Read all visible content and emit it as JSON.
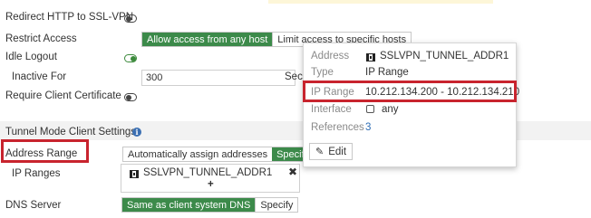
{
  "form": {
    "redirect_label": "Redirect HTTP to SSL-VPN",
    "restrict_label": "Restrict Access",
    "restrict_options": [
      "Allow access from any host",
      "Limit access to specific hosts"
    ],
    "idle_label": "Idle Logout",
    "inactive_label": "Inactive For",
    "inactive_value": "300",
    "inactive_unit_partial": "Seco",
    "client_cert_label": "Require Client Certificate",
    "tunnel_section": "Tunnel Mode Client Settings",
    "address_range_label": "Address Range",
    "address_range_options": [
      "Automatically assign addresses",
      "Specify"
    ],
    "ip_ranges_label": "IP Ranges",
    "ip_range_entry": "SSLVPN_TUNNEL_ADDR1",
    "add_symbol": "+",
    "remove_symbol": "✖",
    "dns_label": "DNS Server",
    "dns_options": [
      "Same as client system DNS",
      "Specify"
    ]
  },
  "popup": {
    "rows": [
      {
        "key": "Address",
        "value": "SSLVPN_TUNNEL_ADDR1"
      },
      {
        "key": "Type",
        "value": "IP Range"
      },
      {
        "key": "IP Range",
        "value": "10.212.134.200 - 10.212.134.210"
      },
      {
        "key": "Interface",
        "value": "any"
      },
      {
        "key": "References",
        "value": "3"
      }
    ],
    "edit_label": "Edit"
  },
  "toggles": {
    "redirect_enabled": false,
    "idle_logout_enabled": true,
    "client_cert_enabled": false
  },
  "colors": {
    "accent_green": "#3c8a4a",
    "highlight_red": "#c8242e",
    "link_blue": "#2f6db5"
  }
}
